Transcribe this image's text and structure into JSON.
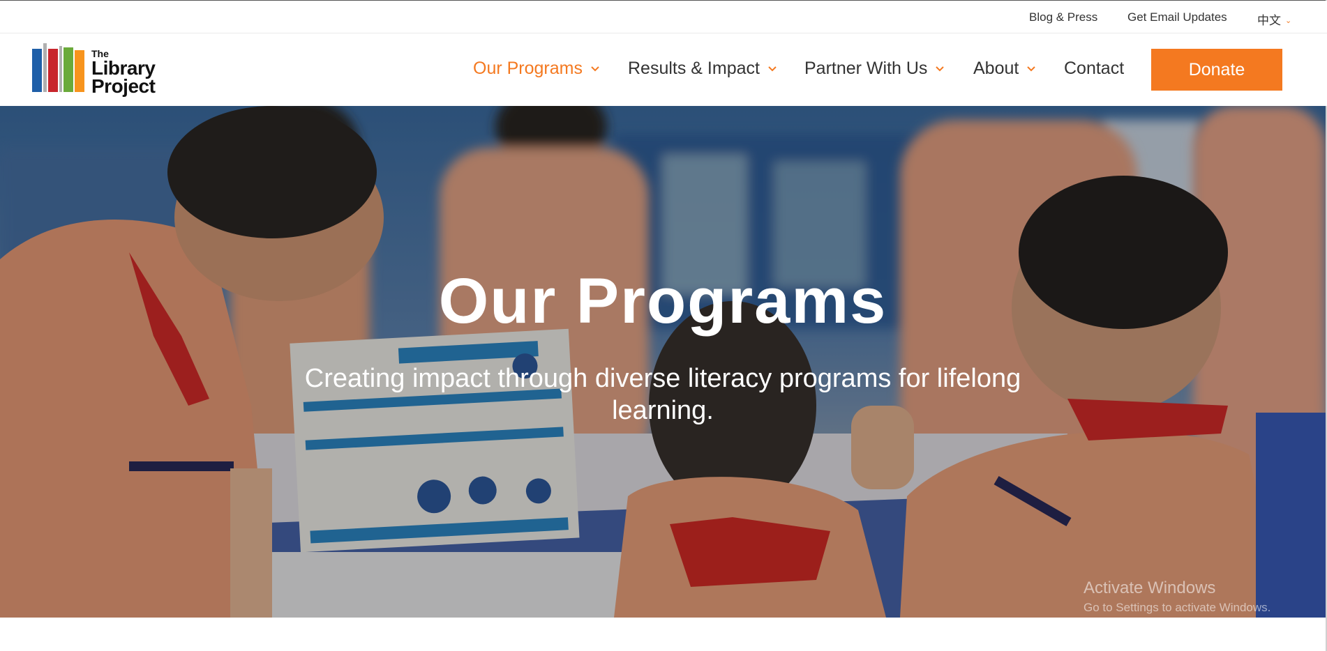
{
  "utility_bar": {
    "blog": "Blog & Press",
    "email": "Get Email Updates",
    "language": "中文"
  },
  "logo": {
    "line1": "The",
    "line2": "Library",
    "line3": "Project"
  },
  "nav": {
    "items": [
      {
        "label": "Our Programs",
        "active": true,
        "has_dropdown": true
      },
      {
        "label": "Results & Impact",
        "has_dropdown": true
      },
      {
        "label": "Partner With Us",
        "has_dropdown": true
      },
      {
        "label": "About",
        "has_dropdown": true
      },
      {
        "label": "Contact",
        "has_dropdown": false
      }
    ],
    "donate": "Donate"
  },
  "hero": {
    "title": "Our Programs",
    "subtitle": "Creating impact through diverse literacy programs for lifelong learning."
  },
  "watermark": {
    "line1": "Activate Windows",
    "line2": "Go to Settings to activate Windows."
  },
  "colors": {
    "accent": "#f47920",
    "text": "#333333",
    "book_blue": "#1f5fa8",
    "book_red": "#c8252c",
    "book_green": "#6aaa3a",
    "book_orange": "#f7941d"
  }
}
